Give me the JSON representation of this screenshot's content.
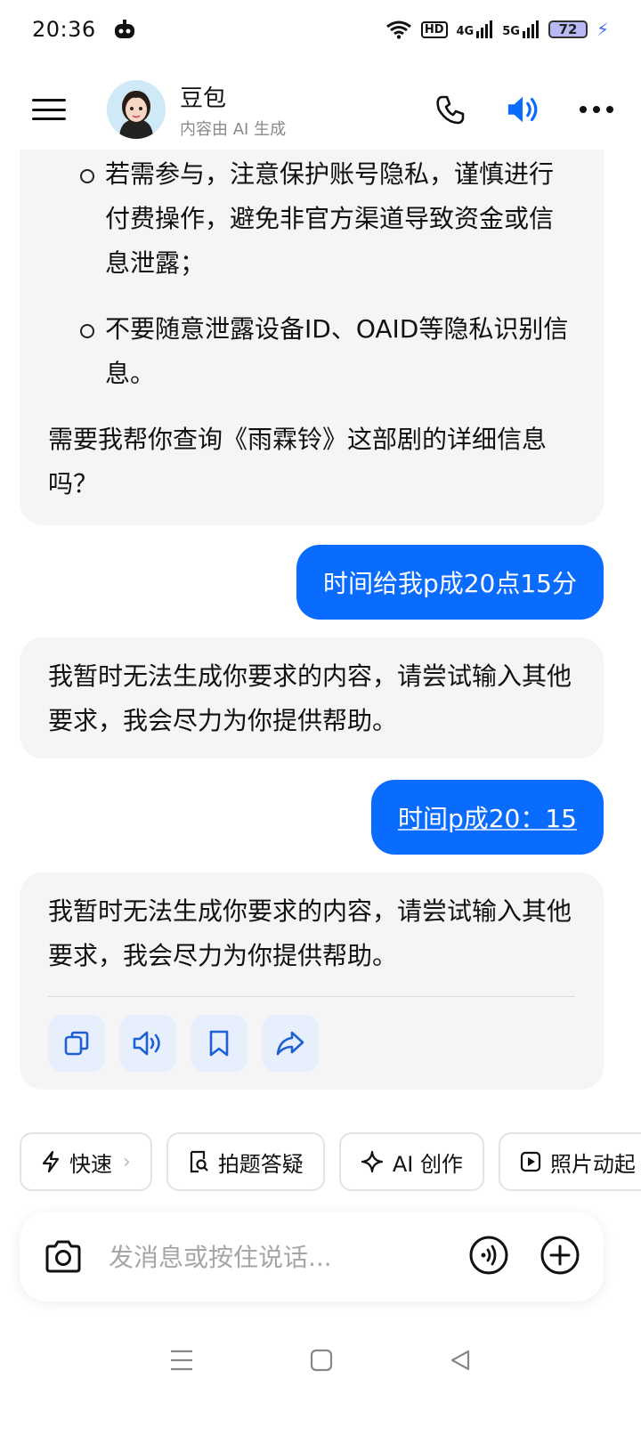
{
  "status_bar": {
    "time": "20:36",
    "signal_1": "4G",
    "signal_2": "5G",
    "battery": "72",
    "hd": "HD"
  },
  "header": {
    "name": "豆包",
    "subtitle": "内容由 AI 生成"
  },
  "messages": {
    "ai_1": {
      "bullets": [
        "若需参与，注意保护账号隐私，谨慎进行付费操作，避免非官方渠道导致资金或信息泄露；",
        "不要随意泄露设备ID、OAID等隐私识别信息。"
      ],
      "followup": "需要我帮你查询《雨霖铃》这部剧的详细信息吗？"
    },
    "user_1": "时间给我p成20点15分",
    "ai_2": "我暂时无法生成你要求的内容，请尝试输入其他要求，我会尽力为你提供帮助。",
    "user_2": "时间p成20：15",
    "ai_3": "我暂时无法生成你要求的内容，请尝试输入其他要求，我会尽力为你提供帮助。"
  },
  "chips": {
    "fast": "快速",
    "photo_qa": "拍题答疑",
    "ai_create": "AI 创作",
    "photo_anim": "照片动起"
  },
  "input": {
    "placeholder": "发消息或按住说话..."
  },
  "colors": {
    "accent": "#0a6cff",
    "bubble_ai_bg": "#f5f5f5"
  }
}
